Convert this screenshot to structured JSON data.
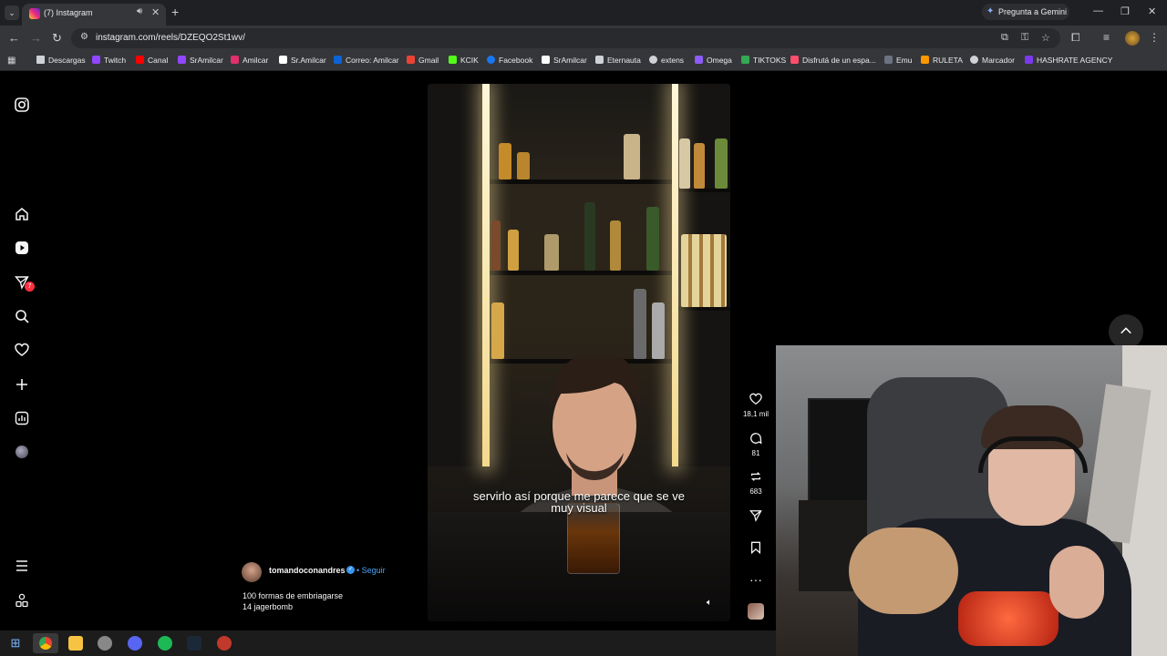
{
  "browser": {
    "tab_title": "(7) Instagram",
    "url": "instagram.com/reels/DZEQO2St1wv/",
    "gemini_label": "Pregunta a Gemini",
    "bookmarks": [
      {
        "label": "Descargas",
        "color": "#cfd2d6"
      },
      {
        "label": "Twitch",
        "color": "#9146ff"
      },
      {
        "label": "Canal",
        "color": "#ff0000"
      },
      {
        "label": "SrAmilcar",
        "color": "#9146ff"
      },
      {
        "label": "Amilcar",
        "color": "#e1306c"
      },
      {
        "label": "Sr.Amilcar",
        "color": "#ffffff"
      },
      {
        "label": "Correo: Amilcar",
        "color": "#0a64d8"
      },
      {
        "label": "Gmail",
        "color": "#ea4335"
      },
      {
        "label": "KCIK",
        "color": "#53fc18"
      },
      {
        "label": "Facebook",
        "color": "#1877f2"
      },
      {
        "label": "SrAmilcar",
        "color": "#ffffff"
      },
      {
        "label": "Eternauta",
        "color": "#cfd2d6"
      },
      {
        "label": "extens",
        "color": "#cfd2d6"
      },
      {
        "label": "Omega",
        "color": "#8b5cf6"
      },
      {
        "label": "TIKTOKS",
        "color": "#34a853"
      },
      {
        "label": "Disfrutá de un espa...",
        "color": "#ff4d6d"
      },
      {
        "label": "Emu",
        "color": "#6b7280"
      },
      {
        "label": "RULETA",
        "color": "#ff9800"
      },
      {
        "label": "Marcador",
        "color": "#cfd2d6"
      },
      {
        "label": "HASHRATE AGENCY",
        "color": "#7c3aed"
      }
    ]
  },
  "sidebar": {
    "notifications_badge": "7"
  },
  "reel": {
    "subtitle_line1": "servirlo así porque me parece que se ve",
    "subtitle_line2": "muy visual",
    "owner": "tomandoconandres",
    "follow_label": "Seguir",
    "caption_line1": "100 formas de embriagarse",
    "caption_line2": "14 jagerbomb",
    "likes": "18,1 mil",
    "comments": "81",
    "reposts": "683"
  },
  "colors": {
    "accent_link": "#4aa3f5",
    "badge": "#ff3040",
    "verified": "#3897f0"
  }
}
